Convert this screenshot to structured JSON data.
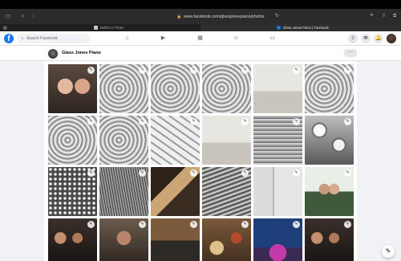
{
  "browser": {
    "url": "www.facebook.com/glassjonespiano/photos",
    "tabs": [
      {
        "label": "Bellini's // Photo",
        "active": false
      },
      {
        "label": "Glass Jones Piano | Facebook",
        "active": true
      }
    ]
  },
  "facebook": {
    "brand_color": "#1877f2",
    "logo_glyph": "f",
    "search_placeholder": "Search Facebook"
  },
  "page": {
    "name": "Glass Jones Piano",
    "more_label": "···"
  },
  "photos": [
    {
      "row": 1,
      "desc": "selfie"
    },
    {
      "row": 1,
      "desc": "sculpture"
    },
    {
      "row": 1,
      "desc": "sculpture"
    },
    {
      "row": 1,
      "desc": "sculpture"
    },
    {
      "row": 1,
      "desc": "gallery"
    },
    {
      "row": 1,
      "desc": "sculpture"
    },
    {
      "row": 2,
      "desc": "sculpture"
    },
    {
      "row": 2,
      "desc": "sculpture"
    },
    {
      "row": 2,
      "desc": "cubes"
    },
    {
      "row": 2,
      "desc": "gallery"
    },
    {
      "row": 2,
      "desc": "stacks"
    },
    {
      "row": 2,
      "desc": "bowls"
    },
    {
      "row": 3,
      "desc": "spheres"
    },
    {
      "row": 3,
      "desc": "fibers"
    },
    {
      "row": 3,
      "desc": "wood"
    },
    {
      "row": 3,
      "desc": "layers"
    },
    {
      "row": 3,
      "desc": "wall"
    },
    {
      "row": 3,
      "desc": "couple"
    },
    {
      "row": 4,
      "desc": "group"
    },
    {
      "row": 4,
      "desc": "man"
    },
    {
      "row": 4,
      "desc": "dinner"
    },
    {
      "row": 4,
      "desc": "food"
    },
    {
      "row": 4,
      "desc": "carnival"
    },
    {
      "row": 4,
      "desc": "group"
    }
  ]
}
